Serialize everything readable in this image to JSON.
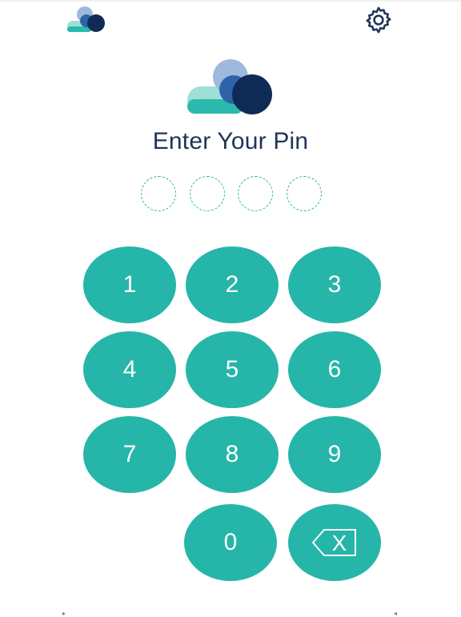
{
  "header": {
    "logo_icon": "cloud-logo-icon",
    "settings_icon": "gear-icon"
  },
  "title": "Enter Your Pin",
  "pin": {
    "length": 4,
    "entered": 0
  },
  "keypad": {
    "keys": [
      "1",
      "2",
      "3",
      "4",
      "5",
      "6",
      "7",
      "8",
      "9",
      "0"
    ],
    "backspace_icon": "backspace-icon",
    "backspace_label": "X"
  },
  "colors": {
    "key_fill": "#26b5a9",
    "title": "#1d3557",
    "logo_teal": "#2bb9ad",
    "logo_light_teal": "#9fe0d6",
    "logo_navy": "#0f2b55",
    "logo_blue": "#2f63a9",
    "logo_light_blue": "#9fb8dc"
  }
}
